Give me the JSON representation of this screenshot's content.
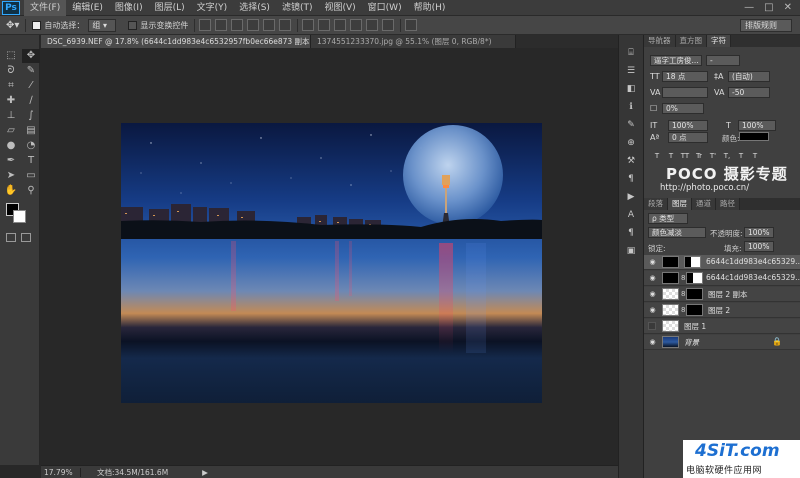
{
  "app": {
    "logo": "Ps"
  },
  "menu": [
    "文件(F)",
    "编辑(E)",
    "图像(I)",
    "图层(L)",
    "文字(Y)",
    "选择(S)",
    "滤镜(T)",
    "视图(V)",
    "窗口(W)",
    "帮助(H)"
  ],
  "window_controls": [
    "—",
    "□",
    "✕"
  ],
  "options": {
    "auto_select_label": "自动选择：",
    "auto_select_value": "组",
    "transform_label": "显示变换控件",
    "workspace": "排版规则"
  },
  "tabs": [
    {
      "label": "DSC_6939.NEF @ 17.8% (6644c1dd983e4c6532957fb0ec66e873 副本, 图层蒙版/8) *",
      "active": true
    },
    {
      "label": "1374551233370.jpg @ 55.1% (图层 0, RGB/8*)",
      "active": false
    }
  ],
  "tab_close": "×",
  "status": {
    "zoom": "17.79%",
    "doc": "文档:34.5M/161.6M",
    "arrow": "▶"
  },
  "panels": {
    "top_tabs": [
      "导航器",
      "直方图",
      "字符"
    ],
    "font_family": "逼字工房俊...",
    "font_size": "18 点",
    "leading": "(自动)",
    "kerning": "",
    "tracking": "-50",
    "vscale_pct": "0%",
    "hscale": "100%",
    "vscale": "100%",
    "baseline": "0 点",
    "color_label": "颜色:",
    "type_buttons": [
      "T",
      "T",
      "TT",
      "Tr",
      "T'",
      "T,",
      "T",
      "T"
    ],
    "layers_tabs": [
      "段落",
      "图层",
      "通道",
      "路径"
    ],
    "filter_kind": "ρ 类型",
    "blend_mode": "颜色减淡",
    "opacity_label": "不透明度:",
    "opacity": "100%",
    "lock_label": "锁定:",
    "fill_label": "填充:",
    "fill": "100%"
  },
  "layers": [
    {
      "name": "6644c1dd983e4c65329...",
      "visible": true,
      "thumb": "dark",
      "selected": true
    },
    {
      "name": "6644c1dd983e4c65329...",
      "visible": true,
      "thumb": "dark",
      "selected": false
    },
    {
      "name": "图层 2 副本",
      "visible": true,
      "thumb": "checker",
      "selected": false
    },
    {
      "name": "图层 2",
      "visible": true,
      "thumb": "checker",
      "selected": false
    },
    {
      "name": "图层 1",
      "visible": false,
      "thumb": "checker",
      "selected": false
    },
    {
      "name": "背景",
      "visible": true,
      "thumb": "photo",
      "selected": false
    }
  ],
  "watermarks": {
    "poco_title": "POCO 摄影专题",
    "poco_url": "http://photo.poco.cn/",
    "site_logo": "4SiT.com",
    "site_text": "电脑软硬件应用网"
  },
  "colors": {
    "foreground": "#000000",
    "background": "#ffffff",
    "accent": "#31a8ff"
  }
}
